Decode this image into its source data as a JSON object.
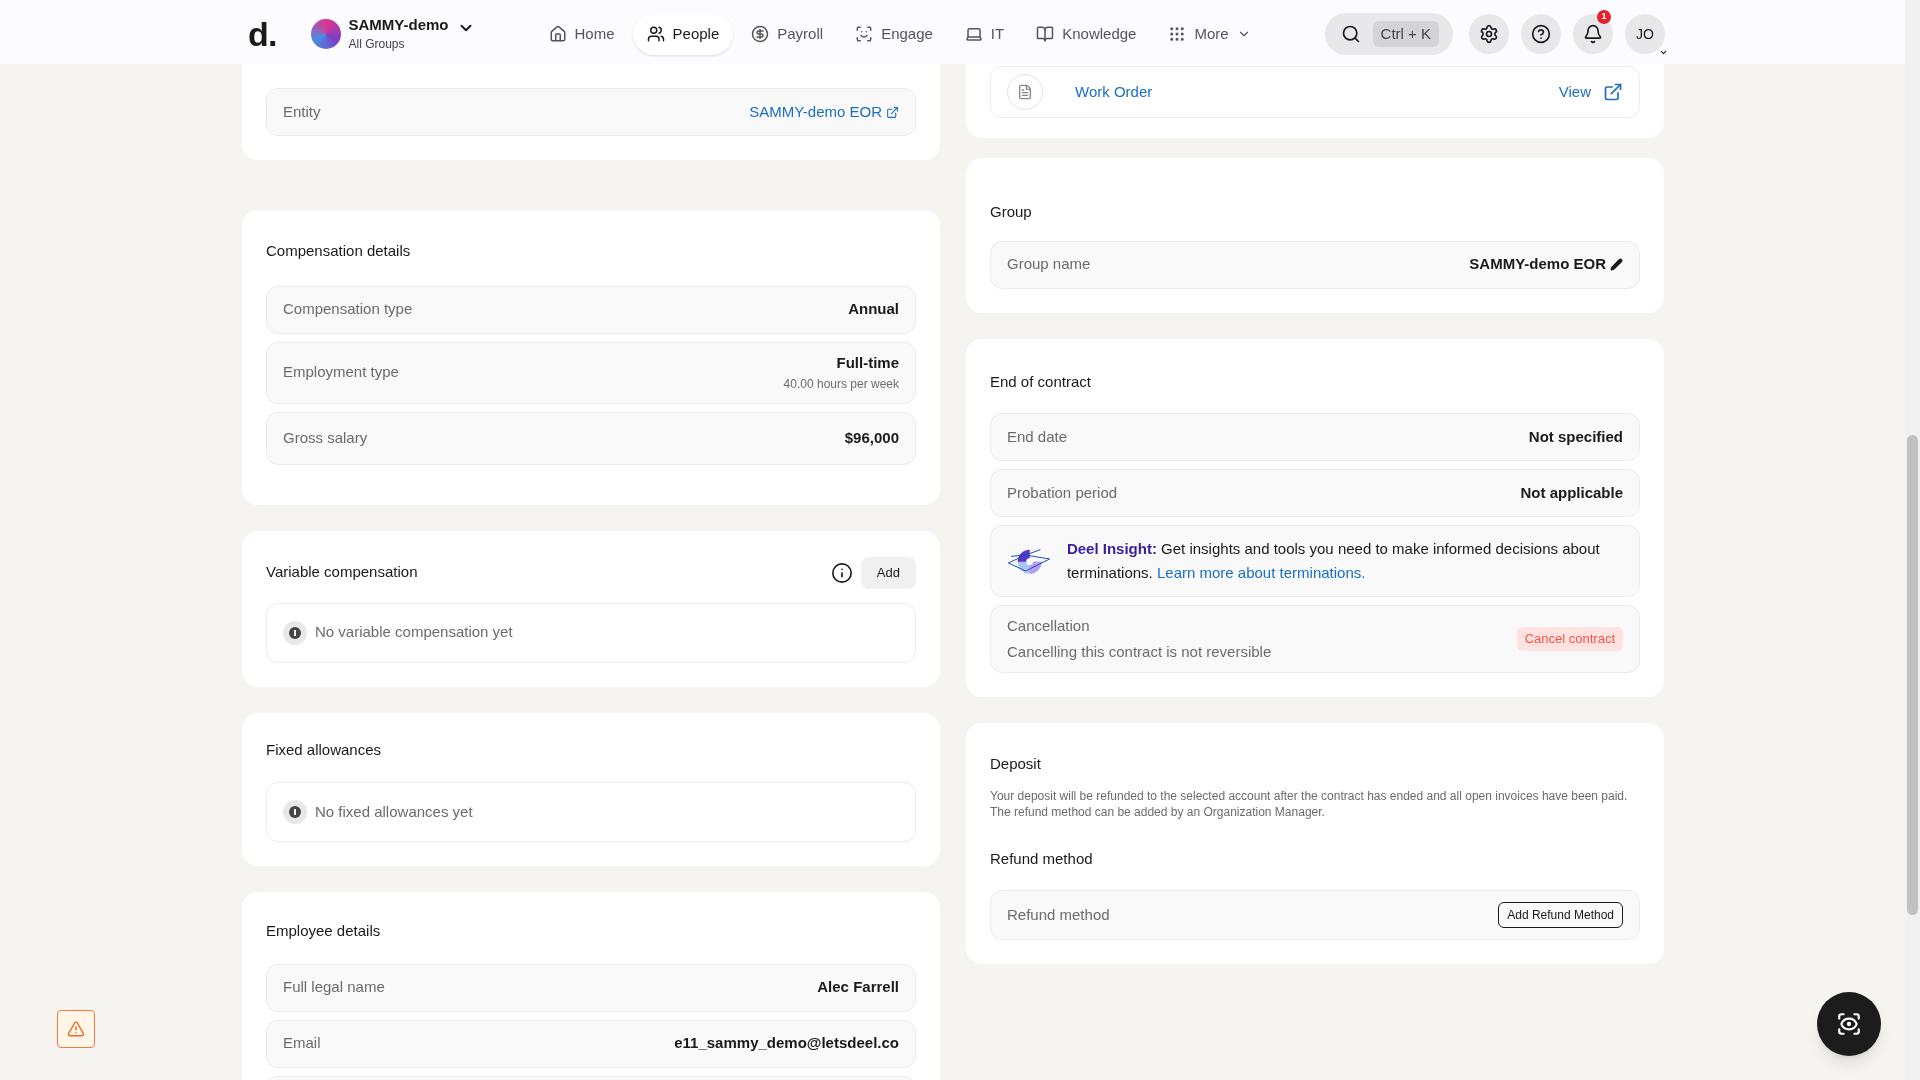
{
  "header": {
    "logo": "d.",
    "org": {
      "name": "SAMMY-demo",
      "subtitle": "All Groups"
    },
    "nav": [
      {
        "label": "Home",
        "selected": false
      },
      {
        "label": "People",
        "selected": true
      },
      {
        "label": "Payroll",
        "selected": false
      },
      {
        "label": "Engage",
        "selected": false
      },
      {
        "label": "IT",
        "selected": false
      },
      {
        "label": "Knowledge",
        "selected": false
      },
      {
        "label": "More",
        "selected": false
      }
    ],
    "search": {
      "shortcut": "Ctrl + K"
    },
    "notifications": "1",
    "user": "JO"
  },
  "terms": {
    "rows": [
      {
        "label": "Entity",
        "value": "SAMMY-demo EOR",
        "kind": "link"
      }
    ]
  },
  "compensation": {
    "title": "Compensation details",
    "rows": [
      {
        "label": "Compensation type",
        "value": "Annual"
      },
      {
        "label": "Employment type",
        "value": "Full-time",
        "note": "40.00 hours per week"
      },
      {
        "label": "Gross salary",
        "value": "$96,000"
      }
    ]
  },
  "variable_compensation": {
    "title": "Variable compensation",
    "button": "Add",
    "empty": "No variable compensation yet"
  },
  "fixed_allowances": {
    "title": "Fixed allowances",
    "empty": "No fixed allowances yet"
  },
  "employee_details": {
    "title": "Employee details",
    "rows": [
      {
        "label": "Full legal name",
        "value": "Alec Farrell"
      },
      {
        "label": "Email",
        "value": "e11_sammy_demo@letsdeel.co"
      }
    ]
  },
  "contract": {
    "document": "Work Order",
    "action": "View"
  },
  "group": {
    "title": "Group",
    "label": "Group name",
    "value": "SAMMY-demo EOR"
  },
  "end_of_contract": {
    "title": "End of contract",
    "rows": [
      {
        "label": "End date",
        "value": "Not specified"
      },
      {
        "label": "Probation period",
        "value": "Not applicable"
      }
    ],
    "insight": {
      "text": "**Deel Insight:** Get insights and tools you need to make informed decisions about terminations.",
      "link": "Learn more about terminations."
    },
    "cancellation": {
      "label": "Cancellation",
      "note": "Cancelling this contract is not reversible",
      "button": "Cancel contract"
    }
  },
  "deposit": {
    "title": "Deposit",
    "description": "Your deposit will be refunded to the selected account after the contract has ended and all open invoices have been paid. The refund method can be added by an Organization Manager.",
    "subtitle": "Refund method",
    "label": "Refund method",
    "button": "Add Refund Method"
  }
}
